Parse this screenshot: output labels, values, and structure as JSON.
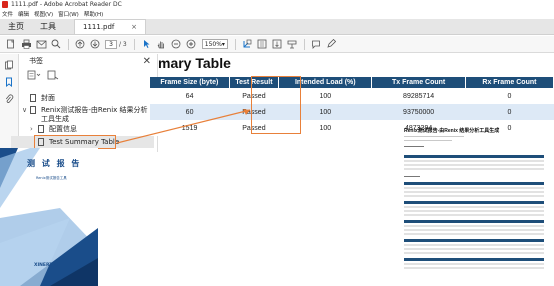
{
  "window": {
    "title": "1111.pdf - Adobe Acrobat Reader DC"
  },
  "menu": [
    "文件",
    "编辑",
    "视图(V)",
    "窗口(W)",
    "帮助(H)"
  ],
  "tabs": {
    "home": "主页",
    "tools": "工具",
    "doc": "1111.pdf",
    "close": "×"
  },
  "toolbar": {
    "page_current": "3",
    "page_total": "/ 3",
    "zoom": "150%"
  },
  "bookmarks": {
    "title": "书签",
    "close": "✕",
    "items": [
      {
        "label": "封面"
      },
      {
        "label": "Renix测试报告-由Renix 结果分析工具生成"
      },
      {
        "label": "配置信息"
      },
      {
        "label": "Test Summary Table"
      }
    ]
  },
  "document": {
    "heading": "mary Table",
    "table": {
      "headers": [
        "Frame Size (byte)",
        "Test Result",
        "Intended Load (%)",
        "Tx Frame Count",
        "Rx Frame Count"
      ],
      "rows": [
        [
          "64",
          "Passed",
          "100",
          "89285714",
          "0"
        ],
        [
          "60",
          "Passed",
          "100",
          "93750000",
          "0"
        ],
        [
          "1519",
          "Passed",
          "100",
          "4873294",
          "0"
        ]
      ]
    },
    "thumbnail_title": "Renix测试报告-由Renix 结果分析工具生成"
  },
  "cover": {
    "title": "测 试 报 告",
    "subtitle": "Renix测试报告工具",
    "logo": "XINERTEL"
  },
  "colors": {
    "accent": "#e8803a",
    "header_blue": "#1e4e79",
    "row_alt": "#dde9f6",
    "pdf_red": "#d9261c"
  }
}
